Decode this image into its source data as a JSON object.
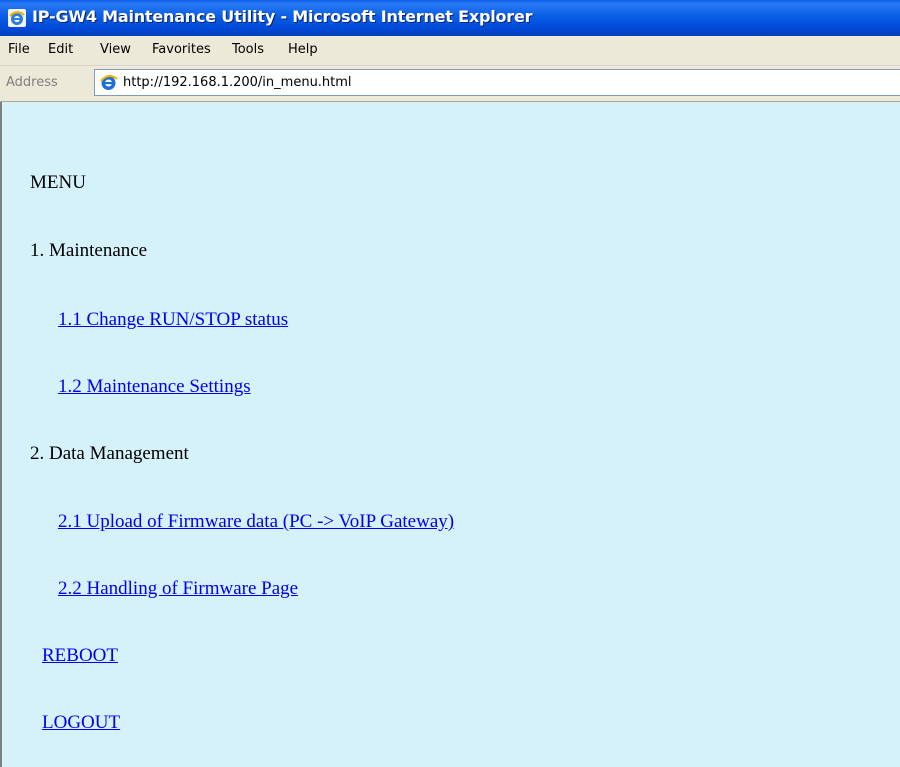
{
  "window": {
    "title": "IP-GW4 Maintenance Utility - Microsoft Internet Explorer",
    "icon": "ie-window-icon"
  },
  "menubar": {
    "items": [
      {
        "label": "File"
      },
      {
        "label": "Edit"
      },
      {
        "label": "View"
      },
      {
        "label": "Favorites"
      },
      {
        "label": "Tools"
      },
      {
        "label": "Help"
      }
    ]
  },
  "addressbar": {
    "label": "Address",
    "url": "http://192.168.1.200/in_menu.html",
    "icon": "ie-page-icon"
  },
  "content": {
    "background": "#d5f1fa",
    "heading": "MENU",
    "section1": "1. Maintenance",
    "link_1_1": "1.1 Change RUN/STOP status",
    "link_1_2": "1.2 Maintenance Settings",
    "section2": "2. Data Management",
    "link_2_1": "2.1 Upload of Firmware data (PC -> VoIP Gateway)",
    "link_2_2": "2.2 Handling of Firmware Page",
    "reboot": "REBOOT",
    "logout": "LOGOUT",
    "link_color": "#0000ee"
  }
}
